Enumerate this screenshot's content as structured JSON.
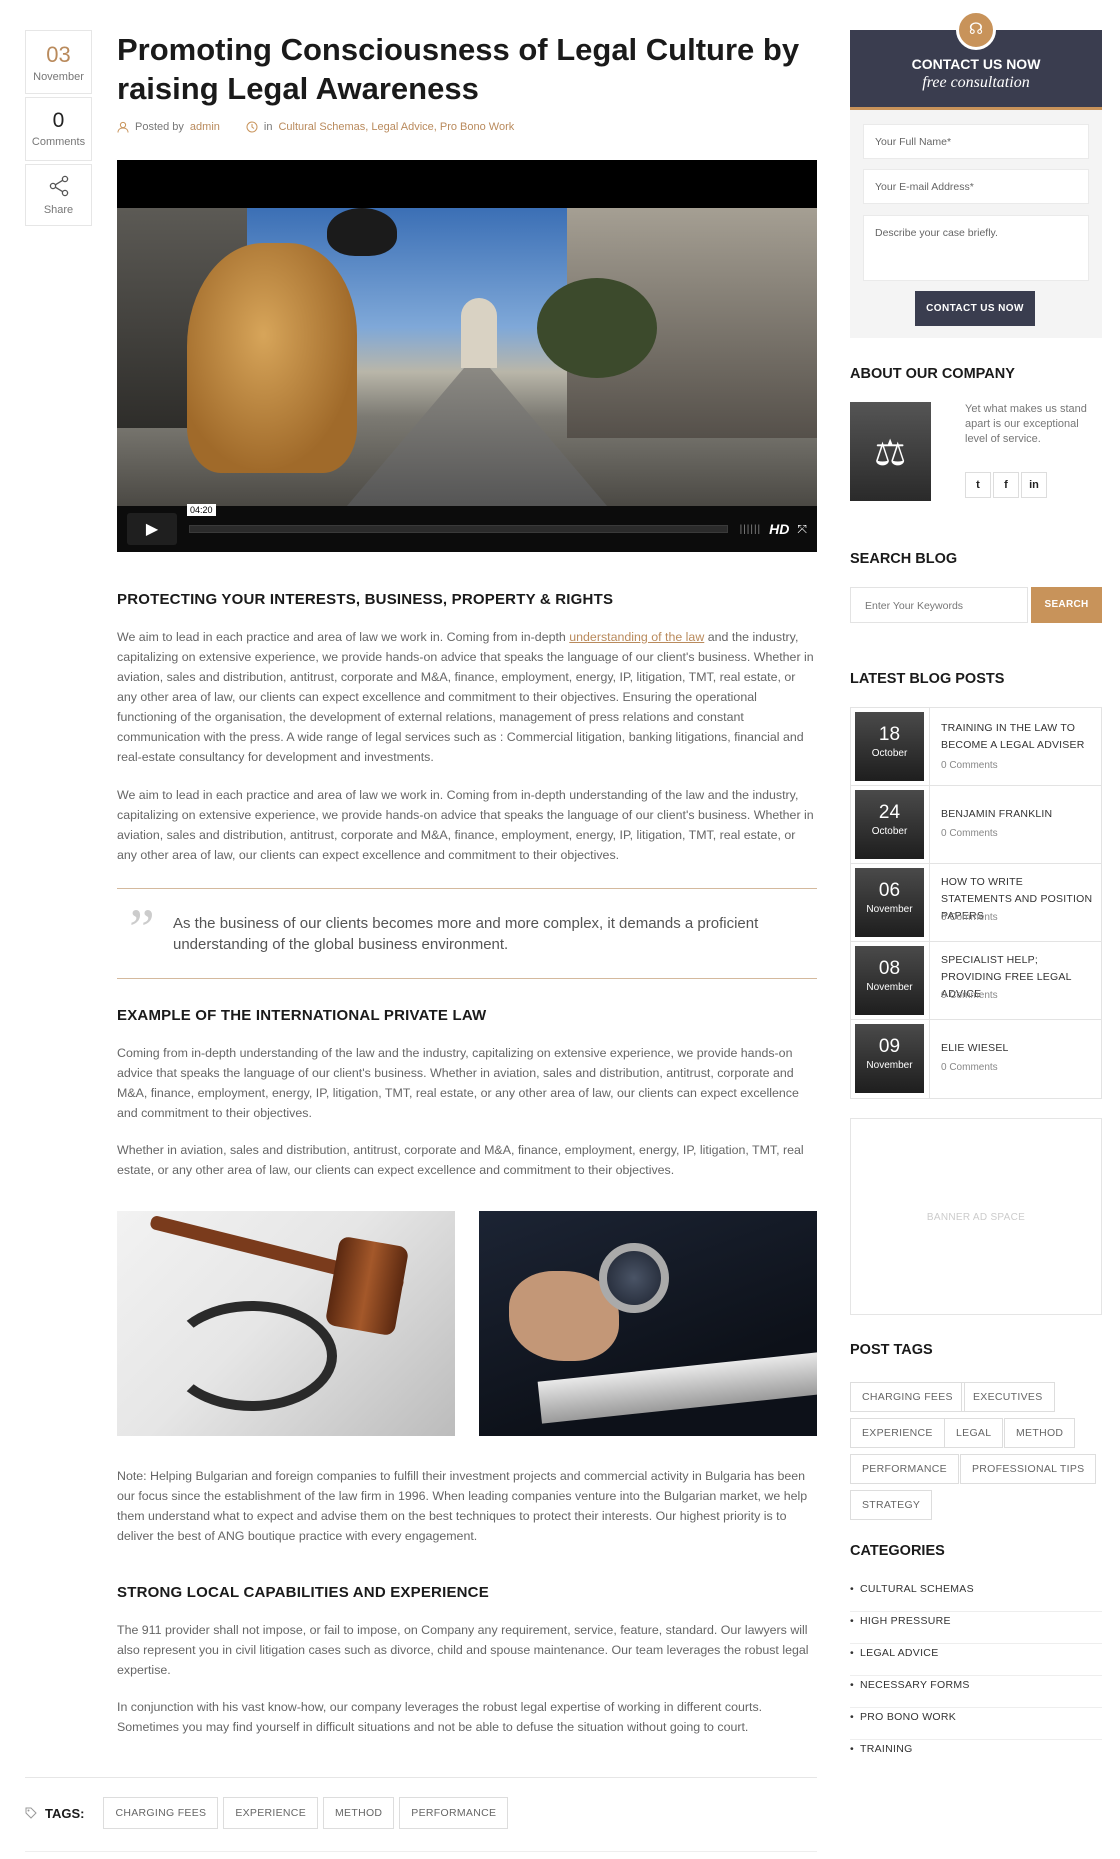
{
  "meta": {
    "date_day": "03",
    "date_month": "November",
    "comments_count": "0",
    "comments_label": "Comments",
    "share_label": "Share"
  },
  "post": {
    "title": "Promoting Consciousness of Legal Culture by raising Legal Awareness",
    "posted_by_label": "Posted by",
    "author": "admin",
    "in_label": "in",
    "categories": "Cultural Schemas, Legal Advice, Pro Bono Work",
    "video_time": "04:20",
    "video_hd": "HD",
    "heading1": "PROTECTING YOUR INTERESTS, BUSINESS, PROPERTY & RIGHTS",
    "p1_before": "We aim to lead in each practice and area of law we work in. Coming from in-depth ",
    "p1_link": "understanding of the law",
    "p1_after": " and the industry, capitalizing on extensive experience, we provide hands-on advice that speaks the language of our client's business. Whether in aviation, sales and distribution, antitrust, corporate and M&A, finance, employment, energy, IP, litigation, TMT, real estate, or any other area of law, our clients can expect excellence and commitment to their objectives. Ensuring the operational functioning of the organisation, the development of external relations, management of press relations and constant communication with the press. A wide range of legal services such as : Commercial litigation, banking litigations, financial and real-estate consultancy for development and investments.",
    "p2": "We aim to lead in each practice and area of law we work in. Coming from in-depth understanding of the law and the industry, capitalizing on extensive experience, we provide hands-on advice that speaks the language of our client's business. Whether in aviation, sales and distribution, antitrust, corporate and M&A, finance, employment, energy, IP, litigation, TMT, real estate, or any other area of law, our clients can expect excellence and commitment to their objectives.",
    "quote": "As the business of our clients becomes more and more complex, it demands a proficient understanding of the global business environment.",
    "heading2": "EXAMPLE OF THE INTERNATIONAL PRIVATE LAW",
    "p3": "Coming from in-depth understanding of the law and the industry, capitalizing on extensive experience, we provide hands-on advice that speaks the language of our client's business. Whether in aviation, sales and distribution, antitrust, corporate and M&A, finance, employment, energy, IP, litigation, TMT, real estate, or any other area of law, our clients can expect excellence and commitment to their objectives.",
    "p4": "Whether in aviation, sales and distribution, antitrust, corporate and M&A, finance, employment, energy, IP, litigation, TMT, real estate, or any other area of law, our clients can expect excellence and commitment to their objectives.",
    "p5": "Note: Helping Bulgarian and foreign companies to fulfill their investment projects and commercial activity in Bulgaria has been our focus since the establishment of the law firm in 1996. When leading companies venture into the Bulgarian market, we help them understand what to expect and advise them on the best techniques to protect their interests. Our highest priority is to deliver the best of ANG boutique practice with every engagement.",
    "heading3": "STRONG LOCAL CAPABILITIES AND EXPERIENCE",
    "p6": "The 911 provider shall not impose, or fail to impose, on Company any requirement, service, feature, standard. Our lawyers will also represent you in civil litigation cases such as divorce, child and spouse maintenance. Our team leverages the robust legal expertise.",
    "p7": "In conjunction with his vast know-how, our company leverages the robust legal expertise of working in different courts. Sometimes you may find yourself in difficult situations and not be able to defuse the situation without going to court.",
    "tags_label": "TAGS:",
    "tags": [
      "CHARGING FEES",
      "EXPERIENCE",
      "METHOD",
      "PERFORMANCE"
    ]
  },
  "sidebar": {
    "contact": {
      "title": "CONTACT US NOW",
      "subtitle": "free consultation",
      "name_placeholder": "Your Full Name*",
      "email_placeholder": "Your E-mail Address*",
      "case_placeholder": "Describe your case briefly.",
      "button": "CONTACT US NOW"
    },
    "about": {
      "title": "ABOUT OUR COMPANY",
      "text": "Yet what makes us stand apart is our exceptional level of service.",
      "social": [
        "t",
        "f",
        "in"
      ]
    },
    "search": {
      "title": "SEARCH BLOG",
      "placeholder": "Enter Your Keywords",
      "button": "SEARCH"
    },
    "latest": {
      "title": "LATEST BLOG POSTS",
      "posts": [
        {
          "day": "18",
          "month": "October",
          "title": "TRAINING IN THE LAW TO BECOME A LEGAL ADVISER",
          "comments": "0 Comments"
        },
        {
          "day": "24",
          "month": "October",
          "title": "BENJAMIN FRANKLIN",
          "comments": "0 Comments"
        },
        {
          "day": "06",
          "month": "November",
          "title": "HOW TO WRITE STATEMENTS AND POSITION PAPERS",
          "comments": "0 Comments"
        },
        {
          "day": "08",
          "month": "November",
          "title": "SPECIALIST HELP; PROVIDING FREE LEGAL ADVICE",
          "comments": "0 Comments"
        },
        {
          "day": "09",
          "month": "November",
          "title": "ELIE WIESEL",
          "comments": "0 Comments"
        }
      ]
    },
    "banner": "BANNER AD SPACE",
    "post_tags": {
      "title": "POST TAGS",
      "tags": [
        "CHARGING FEES",
        "EXECUTIVES",
        "EXPERIENCE",
        "LEGAL",
        "METHOD",
        "PERFORMANCE",
        "PROFESSIONAL TIPS",
        "STRATEGY"
      ]
    },
    "categories": {
      "title": "CATEGORIES",
      "items": [
        "CULTURAL SCHEMAS",
        "HIGH PRESSURE",
        "LEGAL ADVICE",
        "NECESSARY FORMS",
        "PRO BONO WORK",
        "TRAINING"
      ]
    },
    "colors": {
      "accent": "#c8935a",
      "dark": "#3a3d4f"
    }
  }
}
